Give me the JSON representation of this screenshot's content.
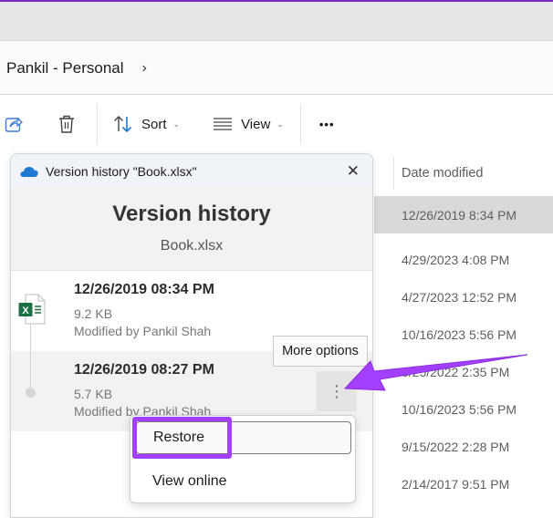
{
  "breadcrumb": {
    "items": [
      "Pankil - Personal"
    ],
    "separator": "›"
  },
  "toolbar": {
    "share_icon": "share-icon",
    "delete_icon": "trash-icon",
    "sort_label": "Sort",
    "view_label": "View",
    "more_label": "•••"
  },
  "file_list": {
    "column_header": "Date modified",
    "rows": [
      {
        "date": "12/26/2019 8:34 PM",
        "selected": true
      },
      {
        "date": "4/29/2023 4:08 PM"
      },
      {
        "date": "4/27/2023 12:52 PM"
      },
      {
        "date": "10/16/2023 5:56 PM"
      },
      {
        "date": "8/25/2022 2:35 PM"
      },
      {
        "date": "10/16/2023 5:56 PM"
      },
      {
        "date": "9/15/2022 2:28 PM"
      },
      {
        "date": "2/14/2017 9:51 PM"
      }
    ]
  },
  "version_panel": {
    "window_title": "Version history \"Book.xlsx\"",
    "close_label": "✕",
    "heading": "Version history",
    "file_name": "Book.xlsx",
    "versions": [
      {
        "date": "12/26/2019 08:34 PM",
        "size": "9.2 KB",
        "modified_by": "Modified by Pankil Shah"
      },
      {
        "date": "12/26/2019 08:27 PM",
        "size": "5.7 KB",
        "modified_by": "Modified by Pankil Shah"
      }
    ],
    "tooltip": "More options",
    "more_options_glyph": "⋮",
    "context_menu": [
      "Restore",
      "View online"
    ]
  },
  "colors": {
    "accent_purple": "#a33fff",
    "onedrive_blue": "#1e78d4",
    "excel_green": "#1d7044"
  }
}
